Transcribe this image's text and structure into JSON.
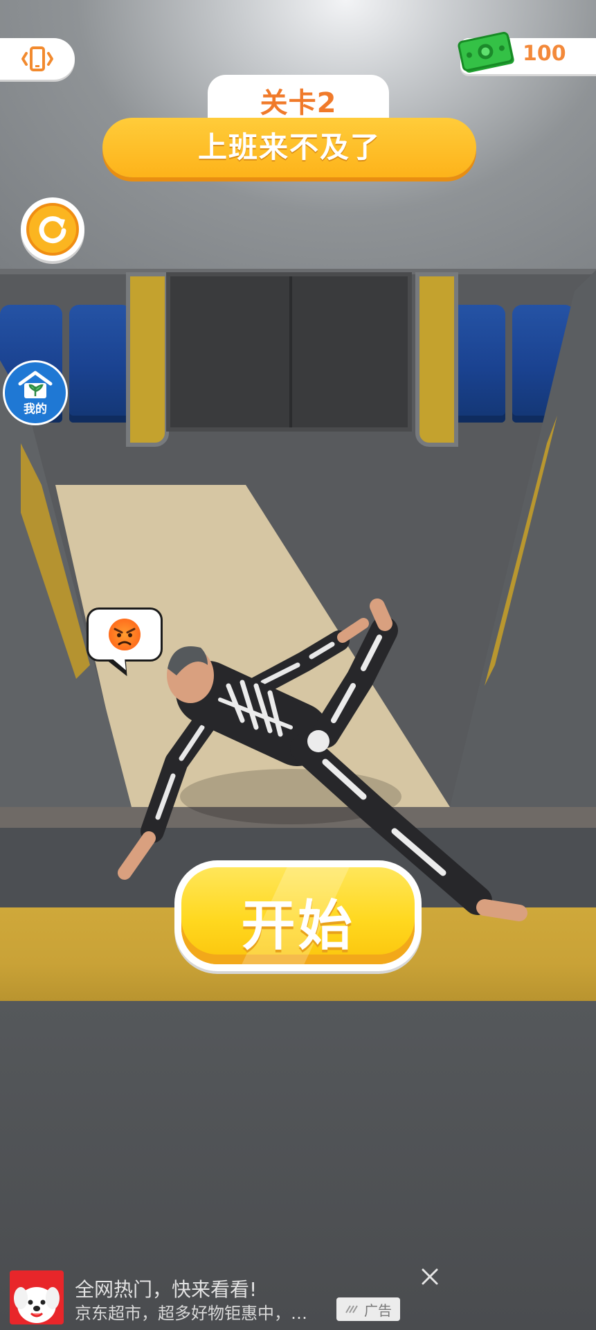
{
  "hud": {
    "vibrate_icon": "phone-vibrate-icon",
    "money_icon": "cash-icon",
    "money_value": "100",
    "restart_icon": "restart-icon",
    "home_icon": "home-plant-icon",
    "home_label": "我的"
  },
  "level": {
    "label": "关卡2",
    "title": "上班来不及了"
  },
  "scene": {
    "emotion_icon": "angry-face-icon"
  },
  "actions": {
    "start_label": "开始"
  },
  "ad": {
    "logo_icon": "jd-dog-logo-icon",
    "title": "全网热门，快来看看!",
    "subtitle": "京东超市，超多好物钜惠中，…",
    "badge": "广告",
    "close_icon": "close-icon"
  },
  "colors": {
    "accent_orange": "#fdb31a",
    "start_yellow": "#ffd81f",
    "money_text": "#f3893a",
    "seat_blue": "#1a4290",
    "home_blue": "#1f78d4"
  }
}
